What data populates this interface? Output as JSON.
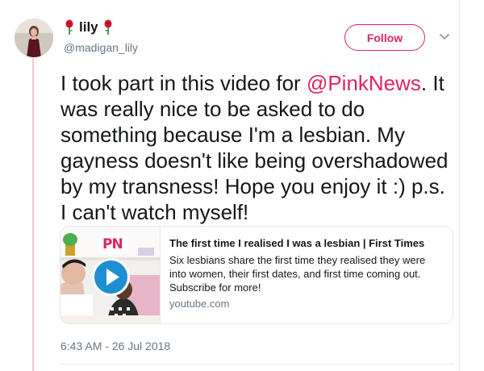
{
  "user": {
    "display_name": "lily",
    "handle": "@madigan_lily"
  },
  "actions": {
    "follow_label": "Follow"
  },
  "tweet": {
    "text_before": "I took part in this video for ",
    "mention": "@PinkNews",
    "text_after": ". It was really nice to be asked to do something because I'm a lesbian. My gayness doesn't like being overshadowed by my transness! Hope you enjoy it :) p.s. I can't watch myself!"
  },
  "card": {
    "title": "The first time I realised I was a lesbian | First Times",
    "description": "Six lesbians share the first time they realised they were into women, their first dates, and first time coming out. Subscribe for more!",
    "domain": "youtube.com",
    "thumbnail_logo": "PN"
  },
  "meta": {
    "timestamp": "6:43 AM - 26 Jul 2018"
  },
  "colors": {
    "accent": "#e0245e",
    "thread_line": "#f5c6d6",
    "muted": "#657786",
    "play_button": "#1d8fd1"
  },
  "icons": [
    "rose-icon",
    "chevron-down-icon",
    "play-icon"
  ]
}
